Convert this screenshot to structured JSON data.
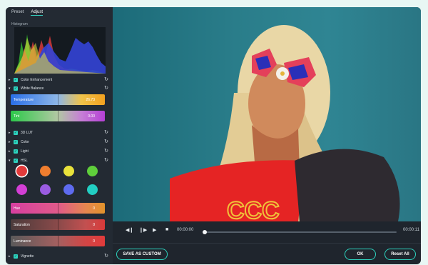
{
  "tabs": {
    "preset": "Preset",
    "adjust": "Adjust"
  },
  "histogram": {
    "label": "Histogram"
  },
  "sections": {
    "color_enhancement": "Color Enhancement",
    "white_balance": "White Balance",
    "lut3d": "3D LUT",
    "color": "Color",
    "light": "Light",
    "hsl": "HSL",
    "vignette": "Vignette"
  },
  "white_balance": {
    "temperature": {
      "label": "Temperature",
      "value": "26.73"
    },
    "tint": {
      "label": "Tint",
      "value": "0.00"
    }
  },
  "hsl_colors": [
    "#e23b3b",
    "#f07e2f",
    "#e9e23b",
    "#5fcf3b",
    "#d33fd6",
    "#9a5ce2",
    "#5e6bf0",
    "#22cec3"
  ],
  "hsl_sliders": {
    "hue": {
      "label": "Hue",
      "value": "0"
    },
    "saturation": {
      "label": "Saturation",
      "value": "0"
    },
    "luminance": {
      "label": "Luminance",
      "value": "0"
    }
  },
  "player": {
    "current_time": "00:00:00",
    "total_time": "00:00:11"
  },
  "buttons": {
    "save_custom": "SAVE AS CUSTOM",
    "ok": "OK",
    "reset_all": "Reset All"
  },
  "accent": "#2dd3bf"
}
